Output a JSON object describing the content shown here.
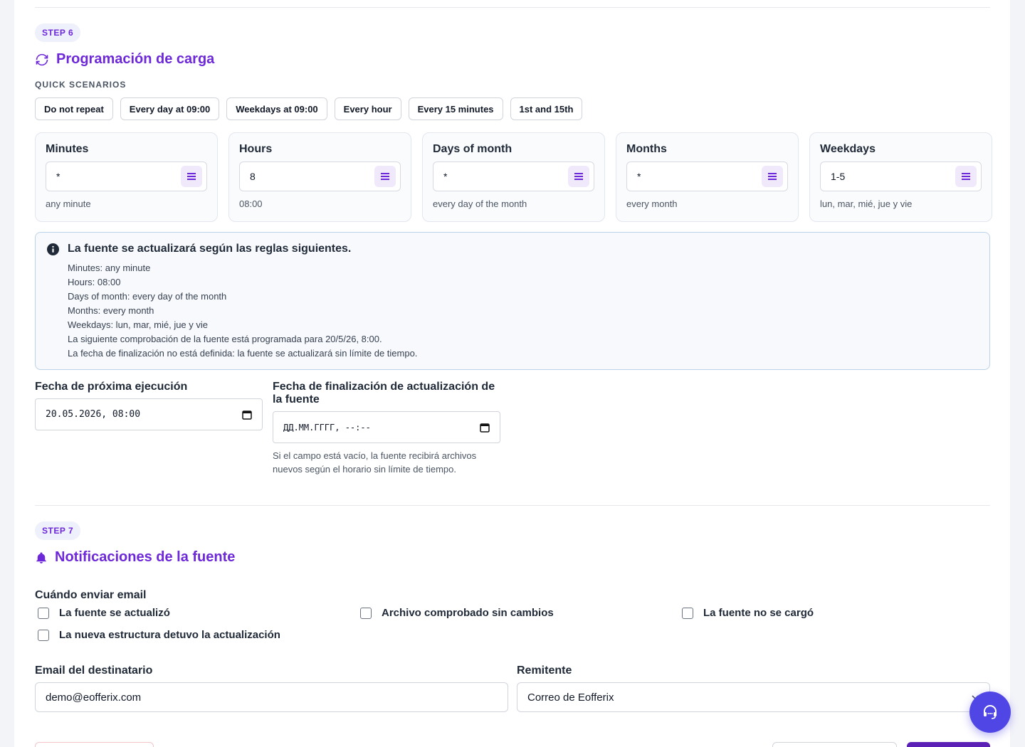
{
  "step6": {
    "badge": "STEP 6",
    "title": "Programación de carga",
    "quick_label": "QUICK SCENARIOS",
    "scenarios": [
      "Do not repeat",
      "Every day at 09:00",
      "Weekdays at 09:00",
      "Every hour",
      "Every 15 minutes",
      "1st and 15th"
    ],
    "cron": [
      {
        "label": "Minutes",
        "value": "*",
        "hint": "any minute"
      },
      {
        "label": "Hours",
        "value": "8",
        "hint": "08:00"
      },
      {
        "label": "Days of month",
        "value": "*",
        "hint": "every day of the month"
      },
      {
        "label": "Months",
        "value": "*",
        "hint": "every month"
      },
      {
        "label": "Weekdays",
        "value": "1-5",
        "hint": "lun, mar, mié, jue y vie"
      }
    ],
    "info": {
      "heading": "La fuente se actualizará según las reglas siguientes.",
      "lines": [
        "Minutes: any minute",
        "Hours: 08:00",
        "Days of month: every day of the month",
        "Months: every month",
        "Weekdays: lun, mar, mié, jue y vie",
        "La siguiente comprobación de la fuente está programada para 20/5/26, 8:00.",
        "La fecha de finalización no está definida: la fuente se actualizará sin límite de tiempo."
      ]
    },
    "next_run": {
      "label": "Fecha de próxima ejecución",
      "value": "20.05.2026, 08:00"
    },
    "end_date": {
      "label": "Fecha de finalización de actualización de la fuente",
      "placeholder": "ДД.ММ.ГГГГ, --:--",
      "help": "Si el campo está vacío, la fuente recibirá archivos nuevos según el horario sin límite de tiempo."
    }
  },
  "step7": {
    "badge": "STEP 7",
    "title": "Notificaciones de la fuente",
    "when_label": "Cuándo enviar email",
    "options": [
      "La fuente se actualizó",
      "Archivo comprobado sin cambios",
      "La fuente no se cargó",
      "La nueva estructura detuvo la actualización"
    ],
    "recipient": {
      "label": "Email del destinatario",
      "value": "demo@eofferix.com"
    },
    "sender": {
      "label": "Remitente",
      "value": "Correo de Eofferix"
    }
  },
  "colors": {
    "accent": "#6d28d9",
    "fab": "#4f46e5"
  },
  "icons": {
    "step6": "refresh-icon",
    "step7": "bell-icon",
    "info": "info-circle-icon",
    "fab": "headset-icon"
  }
}
